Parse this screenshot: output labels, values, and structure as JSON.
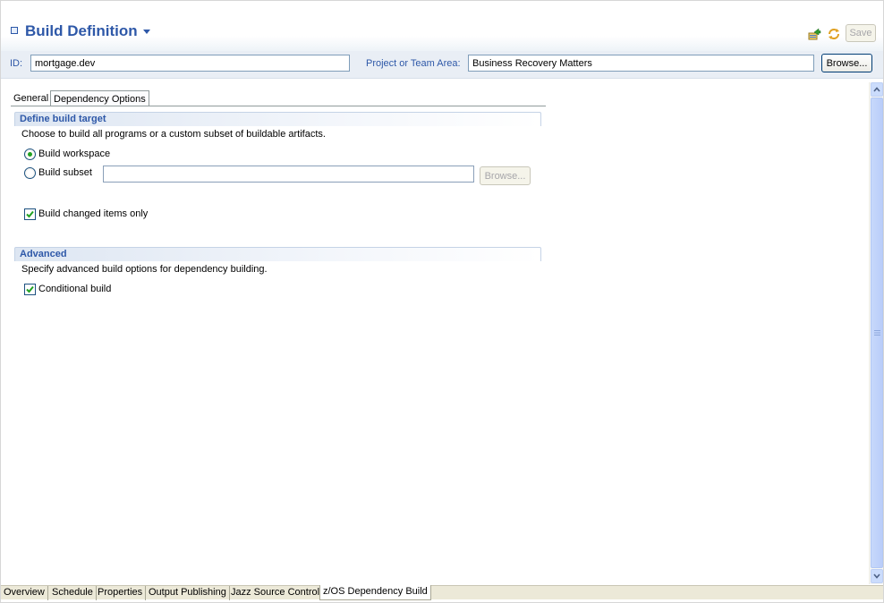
{
  "header": {
    "title": "Build Definition",
    "save_label": "Save",
    "icons": [
      "form-icon",
      "title-menu-icon",
      "submit-build-icon",
      "refresh-icon"
    ]
  },
  "id_bar": {
    "id_label": "ID:",
    "id_value": "mortgage.dev",
    "area_label": "Project or Team Area:",
    "area_value": "Business Recovery Matters",
    "browse_label": "Browse..."
  },
  "tabs": [
    "General",
    "Dependency Options"
  ],
  "define_target": {
    "title": "Define build target",
    "description": "Choose to build all programs or a custom subset of buildable artifacts.",
    "workspace_label": "Build workspace",
    "workspace_selected": true,
    "subset_label": "Build subset",
    "subset_selected": false,
    "subset_value": "",
    "subset_browse_label": "Browse...",
    "changed_only_label": "Build changed items only",
    "changed_only_checked": true
  },
  "advanced": {
    "title": "Advanced",
    "description": "Specify advanced build options for dependency building.",
    "conditional_label": "Conditional build",
    "conditional_checked": true
  },
  "page_tabs": [
    "Overview",
    "Schedule",
    "Properties",
    "Output Publishing",
    "Jazz Source Control",
    "z/OS Dependency Build"
  ],
  "active_page_tab": "z/OS Dependency Build",
  "colors": {
    "title_blue": "#2e58a8",
    "section_bg": "#dde6f2",
    "radio_dot": "#21a121",
    "check_green": "#21a121"
  }
}
